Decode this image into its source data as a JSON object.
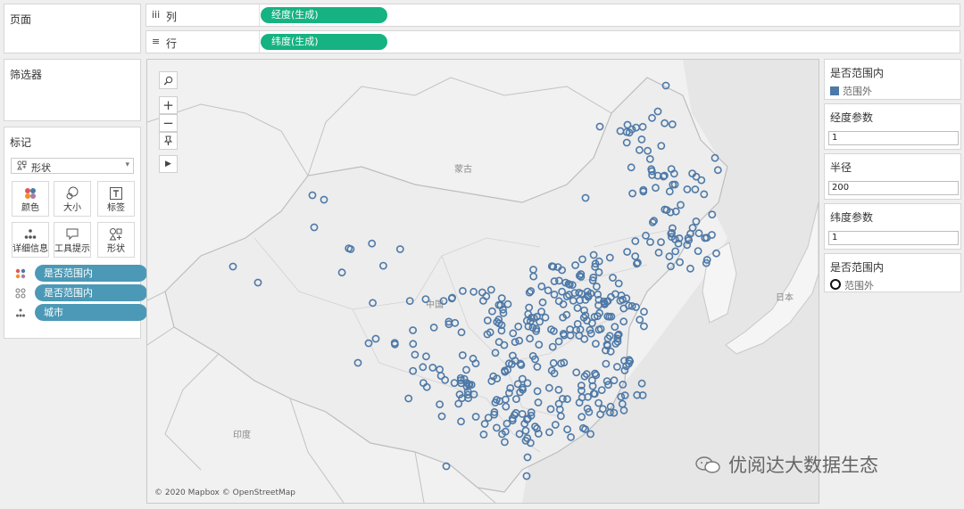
{
  "left": {
    "pages_title": "页面",
    "filters_title": "筛选器",
    "marks": {
      "title": "标记",
      "mark_type": "形状",
      "buttons": [
        {
          "label": "颜色",
          "icon": "color-dots-icon"
        },
        {
          "label": "大小",
          "icon": "size-circles-icon"
        },
        {
          "label": "标签",
          "icon": "text-label-icon"
        },
        {
          "label": "详细信息",
          "icon": "detail-dots-icon"
        },
        {
          "label": "工具提示",
          "icon": "tooltip-icon"
        },
        {
          "label": "形状",
          "icon": "shape-icon"
        }
      ],
      "fields": [
        {
          "label": "是否范围内",
          "icon": "color-dots-icon"
        },
        {
          "label": "是否范围内",
          "icon": "shape-icon"
        },
        {
          "label": "城市",
          "icon": "detail-dots-icon"
        }
      ]
    }
  },
  "shelves": {
    "columns": {
      "icon": "iii",
      "label": "列",
      "pill": "经度(生成)"
    },
    "rows": {
      "icon": "≡",
      "label": "行",
      "pill": "纬度(生成)"
    }
  },
  "map": {
    "labels": {
      "mongolia": "蒙古",
      "china": "中国",
      "india": "印度",
      "japan": "日本"
    },
    "attribution": "© 2020 Mapbox © OpenStreetMap",
    "watermark": "优阅达大数据生态",
    "mark_color": "#4e79a7",
    "tools": [
      "search-icon",
      "zoom-in-icon",
      "zoom-out-icon",
      "pin-icon",
      "expand-arrow-icon"
    ]
  },
  "right": {
    "color_legend": {
      "title": "是否范围内",
      "item": "范围外",
      "color": "#4e79a7"
    },
    "lon_param": {
      "title": "经度参数",
      "value": "1"
    },
    "radius_param": {
      "title": "半径",
      "value": "200"
    },
    "lat_param": {
      "title": "纬度参数",
      "value": "1"
    },
    "shape_legend": {
      "title": "是否范围内",
      "item": "范围外"
    }
  },
  "accent_colors": {
    "field_pill": "#4b99b6",
    "generated_pill": "#16b282"
  }
}
